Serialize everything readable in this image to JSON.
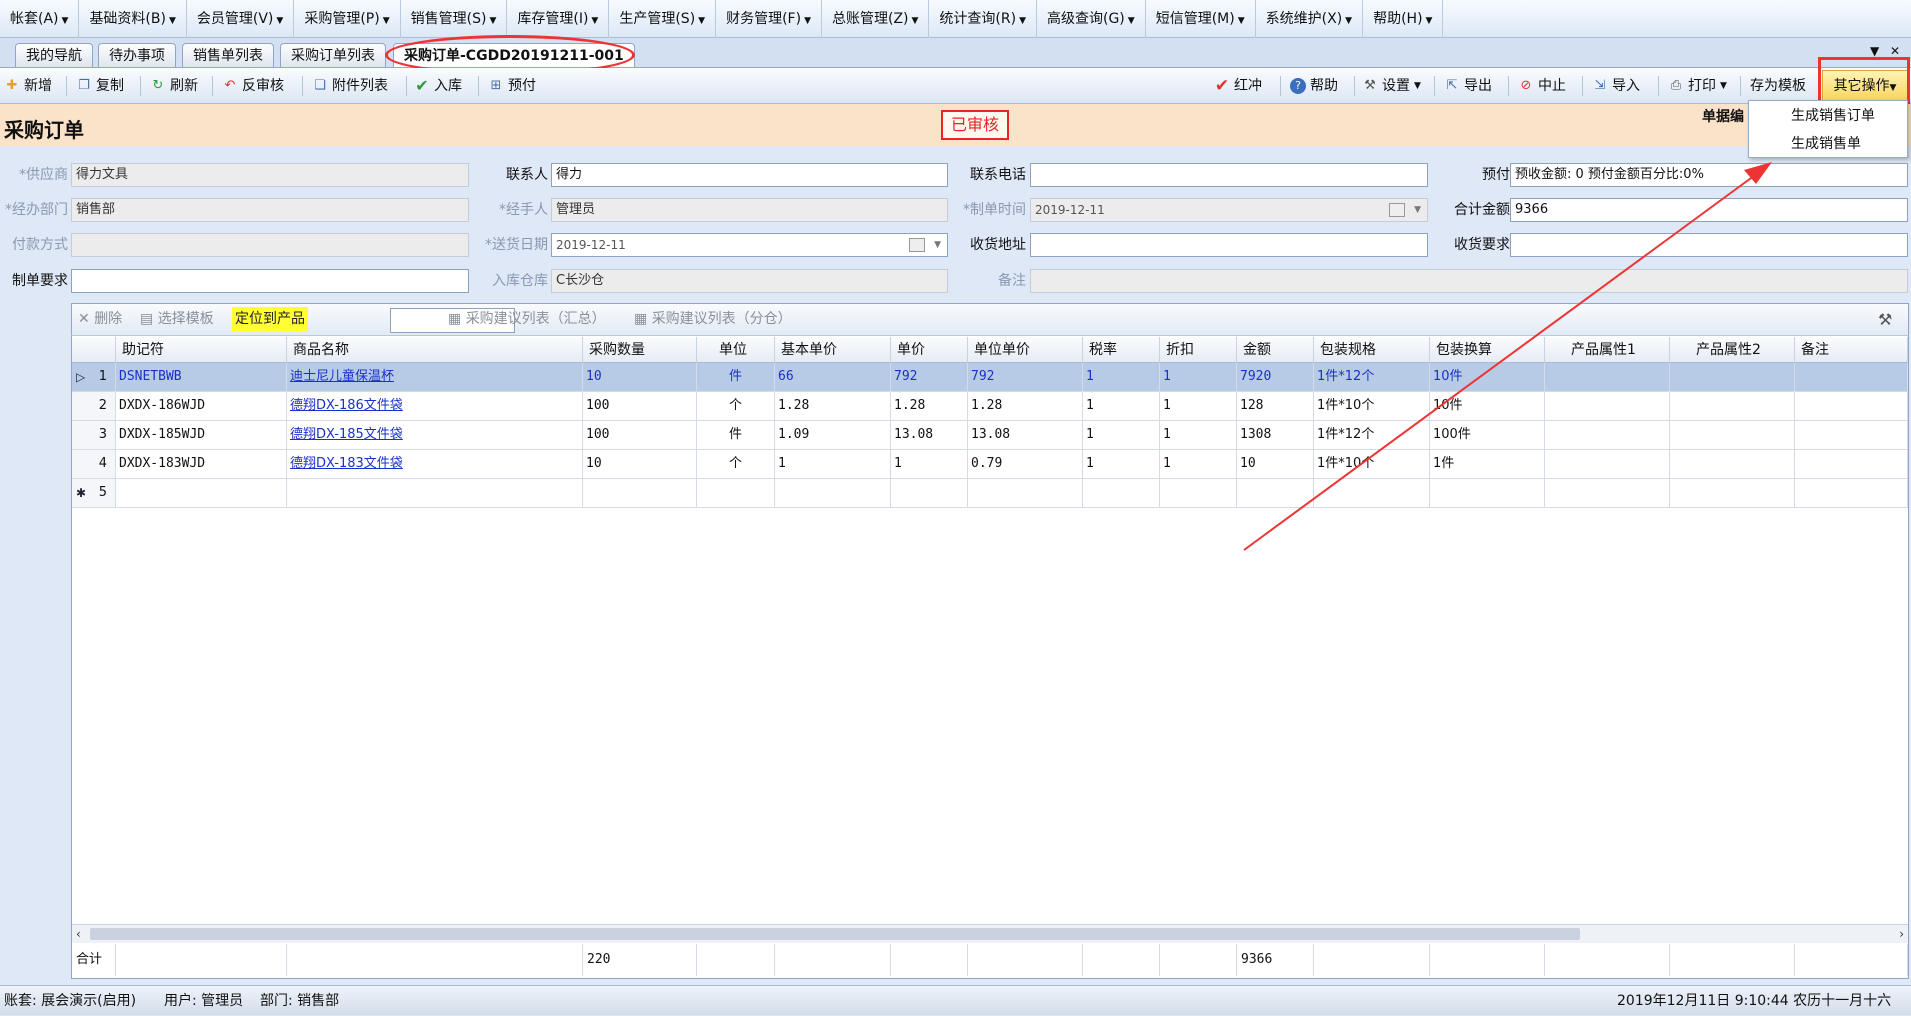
{
  "menu": [
    "帐套(A)",
    "基础资料(B)",
    "会员管理(V)",
    "采购管理(P)",
    "销售管理(S)",
    "库存管理(I)",
    "生产管理(S)",
    "财务管理(F)",
    "总账管理(Z)",
    "统计查询(R)",
    "高级查询(G)",
    "短信管理(M)",
    "系统维护(X)",
    "帮助(H)"
  ],
  "tabs": [
    "我的导航",
    "待办事项",
    "销售单列表",
    "采购订单列表",
    "采购订单-CGDD20191211-001"
  ],
  "toolbar_left": [
    "新增",
    "复制",
    "刷新",
    "反审核",
    "附件列表",
    "入库",
    "预付"
  ],
  "toolbar_right": [
    "红冲",
    "帮助",
    "设置",
    "导出",
    "中止",
    "导入",
    "打印",
    "存为模板"
  ],
  "other_ops": "其它操作",
  "dropdown": [
    "生成销售订单",
    "生成销售单"
  ],
  "header": {
    "title": "采购订单",
    "status": "已审核",
    "doc_label": "单据编"
  },
  "form": {
    "supplier_label": "*供应商",
    "supplier": "得力文具",
    "contact_label": "联系人",
    "contact": "得力",
    "phone_label": "联系电话",
    "phone": "",
    "prepay_label": "预付",
    "prepay": "预收金额: 0  预付金额百分比:0%",
    "dept_label": "*经办部门",
    "dept": "销售部",
    "handler_label": "*经手人",
    "handler": "管理员",
    "created_label": "*制单时间",
    "created": "2019-12-11",
    "total_label": "合计金额",
    "total": "9366",
    "payment_label": "付款方式",
    "payment": "",
    "delivery_label": "*送货日期",
    "delivery": "2019-12-11",
    "address_label": "收货地址",
    "address": "",
    "recv_req_label": "收货要求",
    "recv_req": "",
    "make_req_label": "制单要求",
    "make_req": "",
    "warehouse_label": "入库仓库",
    "warehouse": "C长沙仓",
    "remark_label": "备注",
    "remark": ""
  },
  "grid_toolbar": {
    "delete": "删除",
    "template": "选择模板",
    "locate": "定位到产品",
    "suggest_sum": "采购建议列表（汇总）",
    "suggest_split": "采购建议列表（分仓）"
  },
  "columns": [
    "助记符",
    "商品名称",
    "采购数量",
    "单位",
    "基本单价",
    "单价",
    "单位单价",
    "税率",
    "折扣",
    "金额",
    "包装规格",
    "包装换算",
    "产品属性1",
    "产品属性2",
    "备注"
  ],
  "rows": [
    [
      "DSNETBWB",
      "迪士尼儿童保温杯",
      "10",
      "件",
      "66",
      "792",
      "792",
      "1",
      "1",
      "7920",
      "1件*12个",
      "10件",
      "",
      "",
      ""
    ],
    [
      "DXDX-186WJD",
      "德翔DX-186文件袋",
      "100",
      "个",
      "1.28",
      "1.28",
      "1.28",
      "1",
      "1",
      "128",
      "1件*10个",
      "10件",
      "",
      "",
      ""
    ],
    [
      "DXDX-185WJD",
      "德翔DX-185文件袋",
      "100",
      "件",
      "1.09",
      "13.08",
      "13.08",
      "1",
      "1",
      "1308",
      "1件*12个",
      "100件",
      "",
      "",
      ""
    ],
    [
      "DXDX-183WJD",
      "德翔DX-183文件袋",
      "10",
      "个",
      "1",
      "1",
      "0.79",
      "1",
      "1",
      "10",
      "1件*10个",
      "1件",
      "",
      "",
      ""
    ]
  ],
  "row_numbers": [
    "1",
    "2",
    "3",
    "4",
    "5"
  ],
  "totals": {
    "label": "合计",
    "qty": "220",
    "amount": "9366"
  },
  "status": {
    "account": "账套: 展会演示(启用)",
    "user": "用户: 管理员",
    "dept": "部门: 销售部",
    "datetime": "2019年12月11日 9:10:44 农历十一月十六"
  }
}
